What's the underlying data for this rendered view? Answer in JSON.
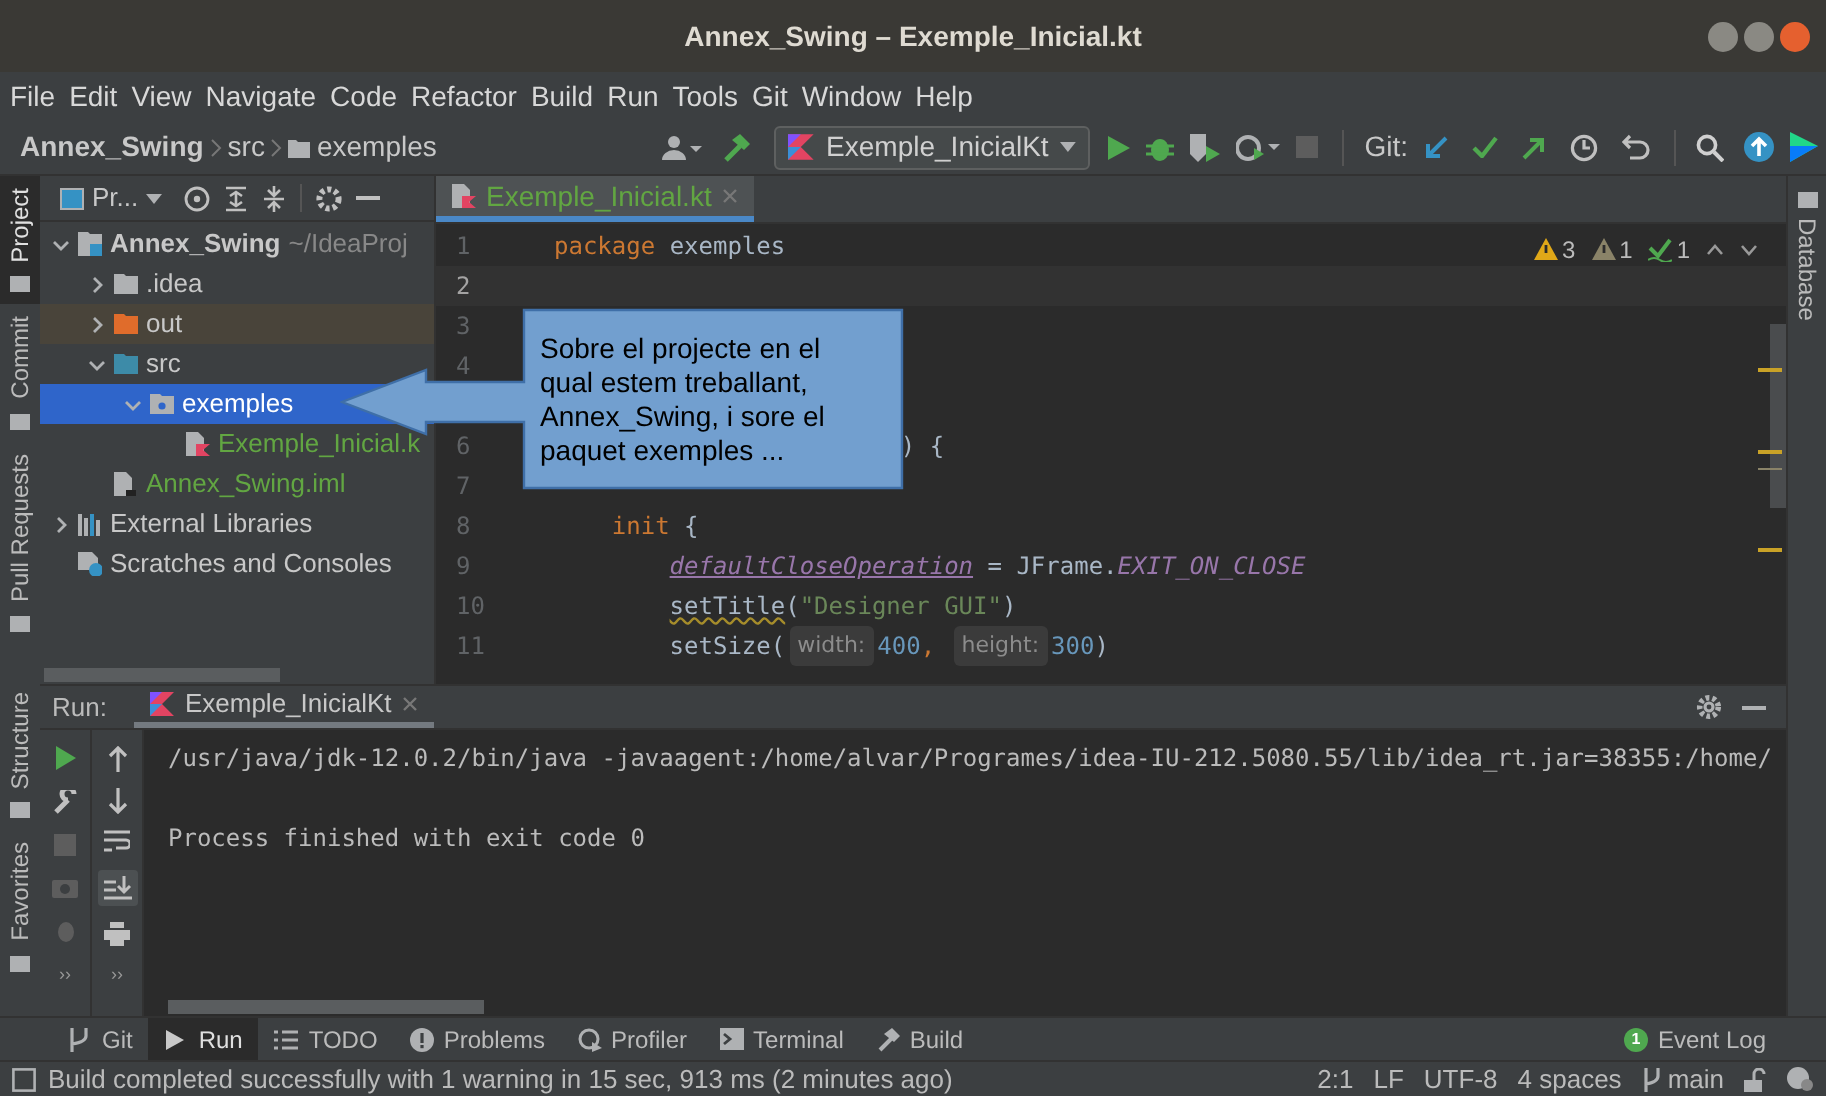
{
  "window": {
    "title": "Annex_Swing – Exemple_Inicial.kt"
  },
  "menu": [
    "File",
    "Edit",
    "View",
    "Navigate",
    "Code",
    "Refactor",
    "Build",
    "Run",
    "Tools",
    "Git",
    "Window",
    "Help"
  ],
  "breadcrumbs": [
    "Annex_Swing",
    "src",
    "exemples"
  ],
  "run_config": "Exemple_InicialKt",
  "git_label": "Git:",
  "left_tabs": [
    {
      "label": "Project",
      "selected": true
    },
    {
      "label": "Commit",
      "selected": false
    },
    {
      "label": "Pull Requests",
      "selected": false
    },
    {
      "label": "Structure",
      "selected": false
    },
    {
      "label": "Favorites",
      "selected": false
    }
  ],
  "right_tabs": [
    {
      "label": "Database",
      "selected": false
    }
  ],
  "project": {
    "title": "Pr...",
    "tree": [
      {
        "label": "Annex_Swing",
        "suffix": "~/IdeaProj",
        "kind": "module",
        "expanded": true,
        "selected": false,
        "children": [
          {
            "label": ".idea",
            "kind": "folder",
            "expanded": false,
            "selected": false
          },
          {
            "label": "out",
            "kind": "excluded",
            "expanded": false,
            "selected": false
          },
          {
            "label": "src",
            "kind": "source",
            "expanded": true,
            "selected": false,
            "children": [
              {
                "label": "exemples",
                "kind": "package",
                "expanded": true,
                "selected": true,
                "children": [
                  {
                    "label": "Exemple_Inicial.k",
                    "kind": "kotlin",
                    "selected": false
                  }
                ]
              }
            ]
          },
          {
            "label": "Annex_Swing.iml",
            "kind": "iml",
            "selected": false
          }
        ]
      },
      {
        "label": "External Libraries",
        "kind": "libraries",
        "expanded": false,
        "selected": false
      },
      {
        "label": "Scratches and Consoles",
        "kind": "scratches",
        "selected": false
      }
    ]
  },
  "editor": {
    "tabs": [
      {
        "label": "Exemple_Inicial.kt",
        "selected": true
      }
    ],
    "inspections": [
      {
        "kind": "warning",
        "count": "3"
      },
      {
        "kind": "weak",
        "count": "1"
      },
      {
        "kind": "typo",
        "count": "1"
      }
    ],
    "lines": [
      {
        "kind": "line",
        "number": "1",
        "current": false,
        "tokens": [
          {
            "kind": "keyword",
            "text": "package"
          },
          {
            "kind": "plain",
            "text": " exemples"
          }
        ]
      },
      {
        "kind": "line",
        "number": "2",
        "current": true
      },
      {
        "kind": "line",
        "number": "3",
        "current": false
      },
      {
        "kind": "line",
        "number": "4",
        "current": false
      },
      {
        "kind": "line_after_gap",
        "number": "6",
        "current": false,
        "tokens": [
          {
            "kind": "plain",
            "text": "                        ) {"
          }
        ]
      },
      {
        "kind": "line",
        "number": "7",
        "current": false
      },
      {
        "kind": "line",
        "number": "8",
        "current": false,
        "tokens": [
          {
            "kind": "keyword",
            "text": "    init"
          },
          {
            "kind": "plain",
            "text": " {"
          }
        ]
      },
      {
        "kind": "line",
        "number": "9",
        "current": false,
        "tokens": [
          {
            "kind": "property",
            "text": "        defaultCloseOperation"
          },
          {
            "kind": "plain",
            "text": " = JFrame."
          },
          {
            "kind": "constant",
            "text": "EXIT_ON_CLOSE"
          }
        ]
      },
      {
        "kind": "line",
        "number": "10",
        "current": false,
        "tokens": [
          {
            "kind": "typo",
            "text": "        setTitle"
          },
          {
            "kind": "plain",
            "text": "("
          },
          {
            "kind": "string",
            "text": "\"Designer GUI\""
          },
          {
            "kind": "plain",
            "text": ")"
          }
        ]
      },
      {
        "kind": "line",
        "number": "11",
        "current": false,
        "tokens": [
          {
            "kind": "plain",
            "text": "        setSize("
          },
          {
            "kind": "hint",
            "text": "width:"
          },
          {
            "kind": "number",
            "text": "400"
          },
          {
            "kind": "keyword",
            "text": ", "
          },
          {
            "kind": "hint",
            "text": "height:"
          },
          {
            "kind": "number",
            "text": "300"
          },
          {
            "kind": "plain",
            "text": ")"
          }
        ]
      }
    ]
  },
  "callout": {
    "text": "Sobre el projecte en el qual estem treballant, Annex_Swing, i sore el paquet exemples ..."
  },
  "run": {
    "label": "Run:",
    "tabs": [
      {
        "label": "Exemple_InicialKt",
        "selected": true
      }
    ],
    "overflow": [
      "››",
      "››"
    ],
    "console": "/usr/java/jdk-12.0.2/bin/java -javaagent:/home/alvar/Programes/idea-IU-212.5080.55/lib/idea_rt.jar=38355:/home/\n\nProcess finished with exit code 0"
  },
  "tool_windows": [
    {
      "label": "Git",
      "kind": "git",
      "selected": false
    },
    {
      "label": "Run",
      "kind": "run",
      "selected": true
    },
    {
      "label": "TODO",
      "kind": "todo",
      "selected": false
    },
    {
      "label": "Problems",
      "kind": "problems",
      "selected": false
    },
    {
      "label": "Profiler",
      "kind": "profiler",
      "selected": false
    },
    {
      "label": "Terminal",
      "kind": "terminal",
      "selected": false
    },
    {
      "label": "Build",
      "kind": "build",
      "selected": false
    }
  ],
  "event_log": {
    "label": "Event Log",
    "badge": "1"
  },
  "status_bar": {
    "message": "Build completed successfully with 1 warning in 15 sec, 913 ms (2 minutes ago)",
    "position": "2:1",
    "line_separator": "LF",
    "encoding": "UTF-8",
    "indent": "4 spaces",
    "branch": "main"
  }
}
